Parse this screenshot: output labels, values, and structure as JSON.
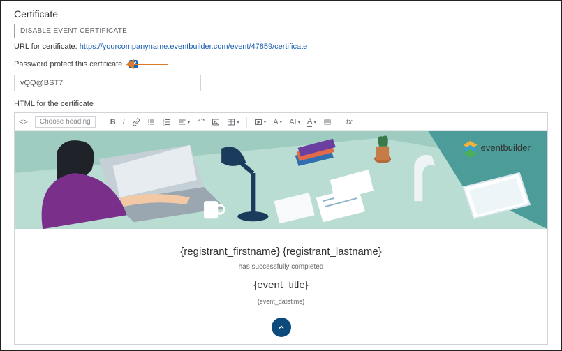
{
  "page": {
    "title": "Certificate",
    "disable_btn": "DISABLE EVENT CERTIFICATE",
    "url_label": "URL for certificate: ",
    "url_value": "https://yourcompanyname.eventbuilder.com/event/47859/certificate",
    "pw_label": "Password protect this certificate",
    "pw_checked": true,
    "pw_value": "vQQ@BST7",
    "html_label": "HTML for the certificate"
  },
  "toolbar": {
    "heading": "Choose heading",
    "fx": "fx"
  },
  "banner": {
    "brand": "eventbuilder"
  },
  "preview": {
    "registrant_line": "{registrant_firstname} {registrant_lastname}",
    "completed_line": "has successfully completed",
    "event_title": "{event_title}",
    "event_datetime": "{event_datetime}"
  },
  "icons": {
    "source": "source-icon",
    "bold": "bold-icon",
    "italic": "italic-icon",
    "link": "link-icon",
    "ul": "bullet-list-icon",
    "ol": "number-list-icon",
    "align": "align-icon",
    "quote": "quote-icon",
    "image": "image-icon",
    "table": "table-icon",
    "media": "media-icon",
    "font": "font-icon",
    "ai": "styles-icon",
    "hl": "highlight-icon",
    "hr": "hr-icon"
  }
}
